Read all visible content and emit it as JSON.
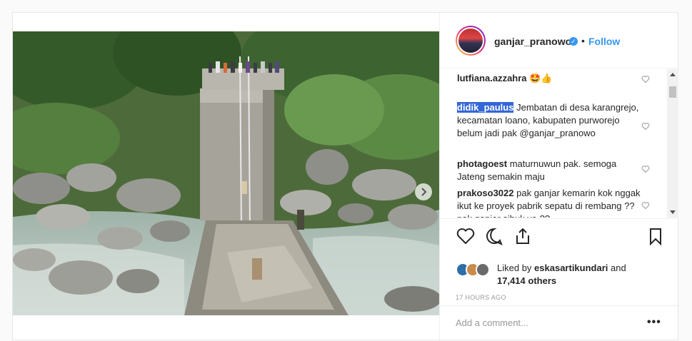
{
  "post": {
    "username": "ganjar_pranowo",
    "verified_mark": "✓",
    "separator": "•",
    "follow_label": "Follow"
  },
  "comments": [
    {
      "username": "lutfiana.azzahra",
      "text": "🤩👍"
    },
    {
      "username": "didik_paulus",
      "text": "Jembatan di desa karangrejo, kecamatan loano, kabupaten purworejo belum jadi pak @ganjar_pranowo"
    },
    {
      "username": "photagoest",
      "text": "maturnuwun pak. semoga Jateng semakin maju"
    },
    {
      "username": "prakoso3022",
      "text": "pak ganjar kemarin kok nggak ikut ke proyek pabrik sepatu di rembang ?? pak ganjar sibuk ya ??"
    }
  ],
  "likes": {
    "prefix": "Liked by",
    "liker": "eskasartikundari",
    "and": "and",
    "others": "17,414 others"
  },
  "timestamp": "17 HOURS AGO",
  "add_comment_placeholder": "Add a comment...",
  "more_label": "•••",
  "colors": {
    "accent": "#3897f0",
    "highlight": "#3367d6",
    "text": "#262626",
    "muted": "#999999"
  }
}
